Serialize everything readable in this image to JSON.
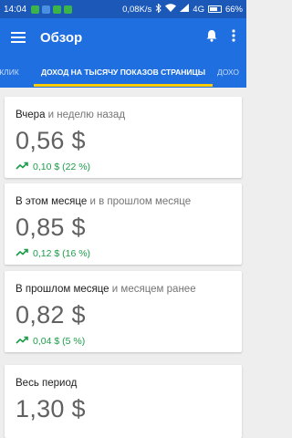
{
  "status_bar": {
    "time": "14:04",
    "network_speed": "0,08K/s",
    "network_type": "4G",
    "battery": "66%",
    "app_icons": [
      "#3bb54a",
      "#4a90e2",
      "#3bb54a",
      "#3bb54a"
    ]
  },
  "app_bar": {
    "title": "Обзор"
  },
  "tabs": [
    {
      "label": "КЛИК"
    },
    {
      "label": "ДОХОД НА ТЫСЯЧУ ПОКАЗОВ СТРАНИЦЫ"
    },
    {
      "label": "ДОХО"
    }
  ],
  "cards": [
    {
      "title": "Вчера",
      "subtitle": "и неделю назад",
      "value": "0,56 $",
      "delta": "0,10 $ (22 %)"
    },
    {
      "title": "В этом месяце",
      "subtitle": "и в прошлом месяце",
      "value": "0,85 $",
      "delta": "0,12 $ (16 %)"
    },
    {
      "title": "В прошлом месяце",
      "subtitle": "и месяцем ранее",
      "value": "0,82 $",
      "delta": "0,04 $ (5 %)"
    },
    {
      "title": "Весь период",
      "value": "1,30 $"
    }
  ],
  "colors": {
    "primary": "#1f6fe0",
    "status_bar": "#1b58b8",
    "tab_indicator": "#ffcc00",
    "positive": "#1b9e49"
  }
}
